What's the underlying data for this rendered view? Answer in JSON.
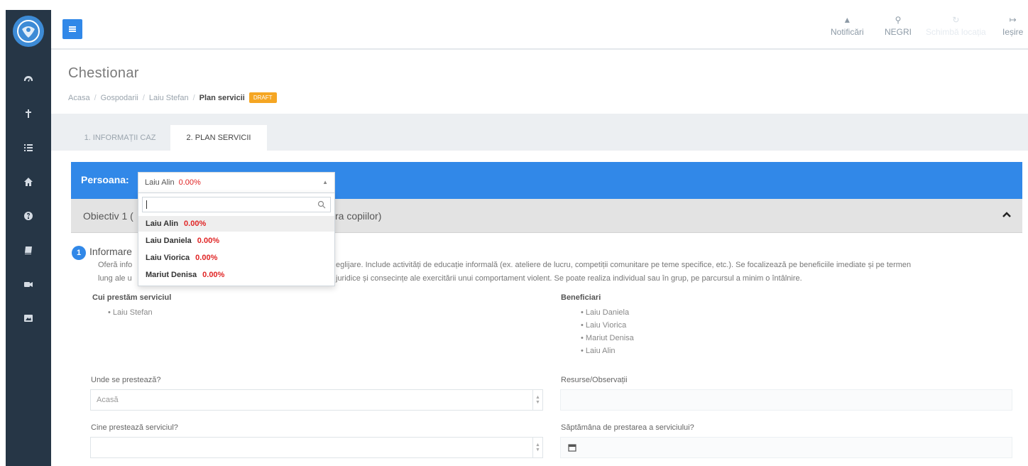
{
  "topbar": {
    "notifications_label": "Notificări",
    "user_label": "NEGRI",
    "change_label": "Schimbă locația",
    "logout_label": "Ieșire"
  },
  "page": {
    "title": "Chestionar",
    "breadcrumb": [
      "Acasa",
      "Gospodarii",
      "Laiu Stefan",
      "Plan servicii"
    ],
    "badge": "DRAFT"
  },
  "tabs": [
    {
      "label": "1. INFORMAȚII CAZ"
    },
    {
      "label": "2. PLAN SERVICII"
    }
  ],
  "persona": {
    "label": "Persoana:",
    "selected_name": "Laiu Alin",
    "selected_pct": "0.00%",
    "options": [
      {
        "name": "Laiu Alin",
        "pct": "0.00%"
      },
      {
        "name": "Laiu Daniela",
        "pct": "0.00%"
      },
      {
        "name": "Laiu Viorica",
        "pct": "0.00%"
      },
      {
        "name": "Mariut Denisa",
        "pct": "0.00%"
      }
    ]
  },
  "objective": {
    "title_start": "Obiectiv 1 (",
    "title_end": "ra copiilor)"
  },
  "section": {
    "number": "1",
    "title": "Informare",
    "desc_line1_start": "Oferă info",
    "desc_line1_end": "eglijare. Include activități de educație informală (ex. ateliere de lucru, competiții comunitare pe teme specifice, etc.). Se focalizează pe beneficiile imediate și pe termen",
    "desc_line2_start": "lung ale u",
    "desc_line2_end": "juridice și consecințe ale exercitării unui comportament violent. Se poate realiza individual sau în grup, pe parcursul a minim o întâlnire."
  },
  "providers": {
    "label": "Cui prestăm serviciul",
    "items": [
      "Laiu Stefan"
    ]
  },
  "beneficiaries": {
    "label": "Beneficiari",
    "items": [
      "Laiu Daniela",
      "Laiu Viorica",
      "Mariut Denisa",
      "Laiu Alin"
    ]
  },
  "form": {
    "where_label": "Unde se prestează?",
    "where_value": "Acasă",
    "resources_label": "Resurse/Observații",
    "who_label": "Cine prestează serviciul?",
    "who_value": "",
    "week_label": "Săptămâna de prestarea a serviciului?"
  },
  "colors": {
    "sidebar": "#263646",
    "accent": "#3188e8",
    "percent": "#e02424",
    "badge": "#f5a623"
  }
}
